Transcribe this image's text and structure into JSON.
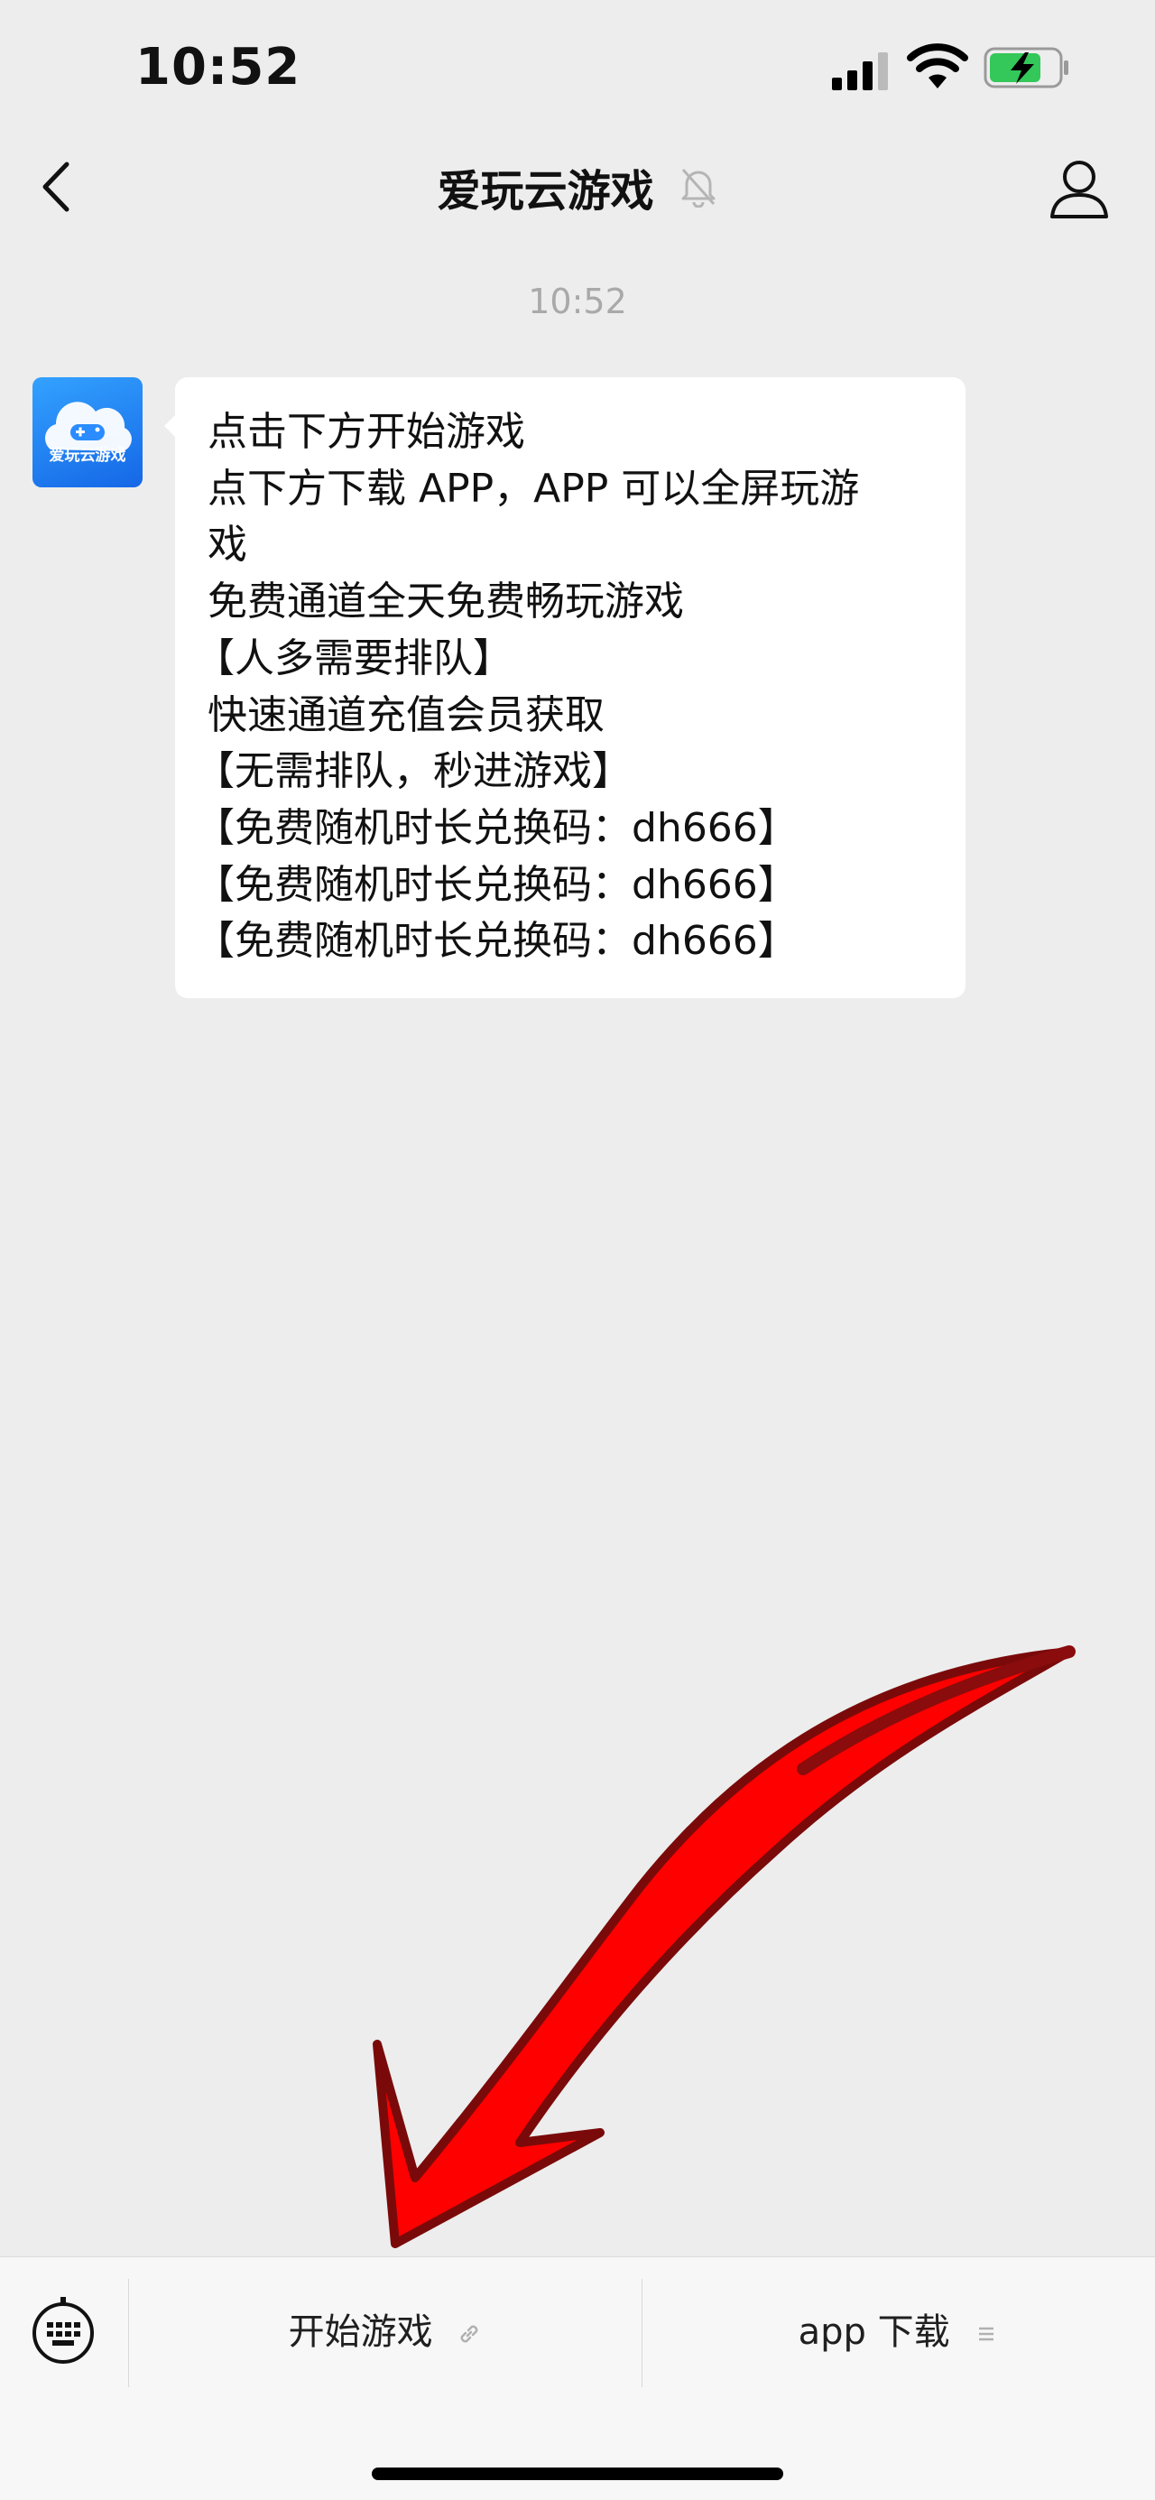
{
  "status_bar": {
    "time": "10:52"
  },
  "nav": {
    "title": "爱玩云游戏"
  },
  "chat": {
    "timestamp": "10:52",
    "avatar_label": "爱玩云游戏",
    "message_lines": [
      "点击下方开始游戏",
      "点下方下载 APP，APP 可以全屏玩游",
      "戏",
      "免费通道全天免费畅玩游戏",
      "【人多需要排队】",
      "快速通道充值会员获取",
      "【无需排队，秒进游戏】",
      "【免费随机时长兑换码：dh666】",
      "【免费随机时长兑换码：dh666】",
      "【免费随机时长兑换码：dh666】"
    ]
  },
  "bottom_menu": {
    "items": [
      {
        "label": "开始游戏",
        "icon": "link-icon"
      },
      {
        "label": "app 下载",
        "icon": "menu-lines-icon"
      }
    ]
  },
  "colors": {
    "background": "#ededed",
    "bubble": "#ffffff",
    "arrow": "#ff0000",
    "arrow_outline": "#7a0a0a",
    "avatar": "#1e7cf0",
    "battery_fill": "#34c759"
  }
}
